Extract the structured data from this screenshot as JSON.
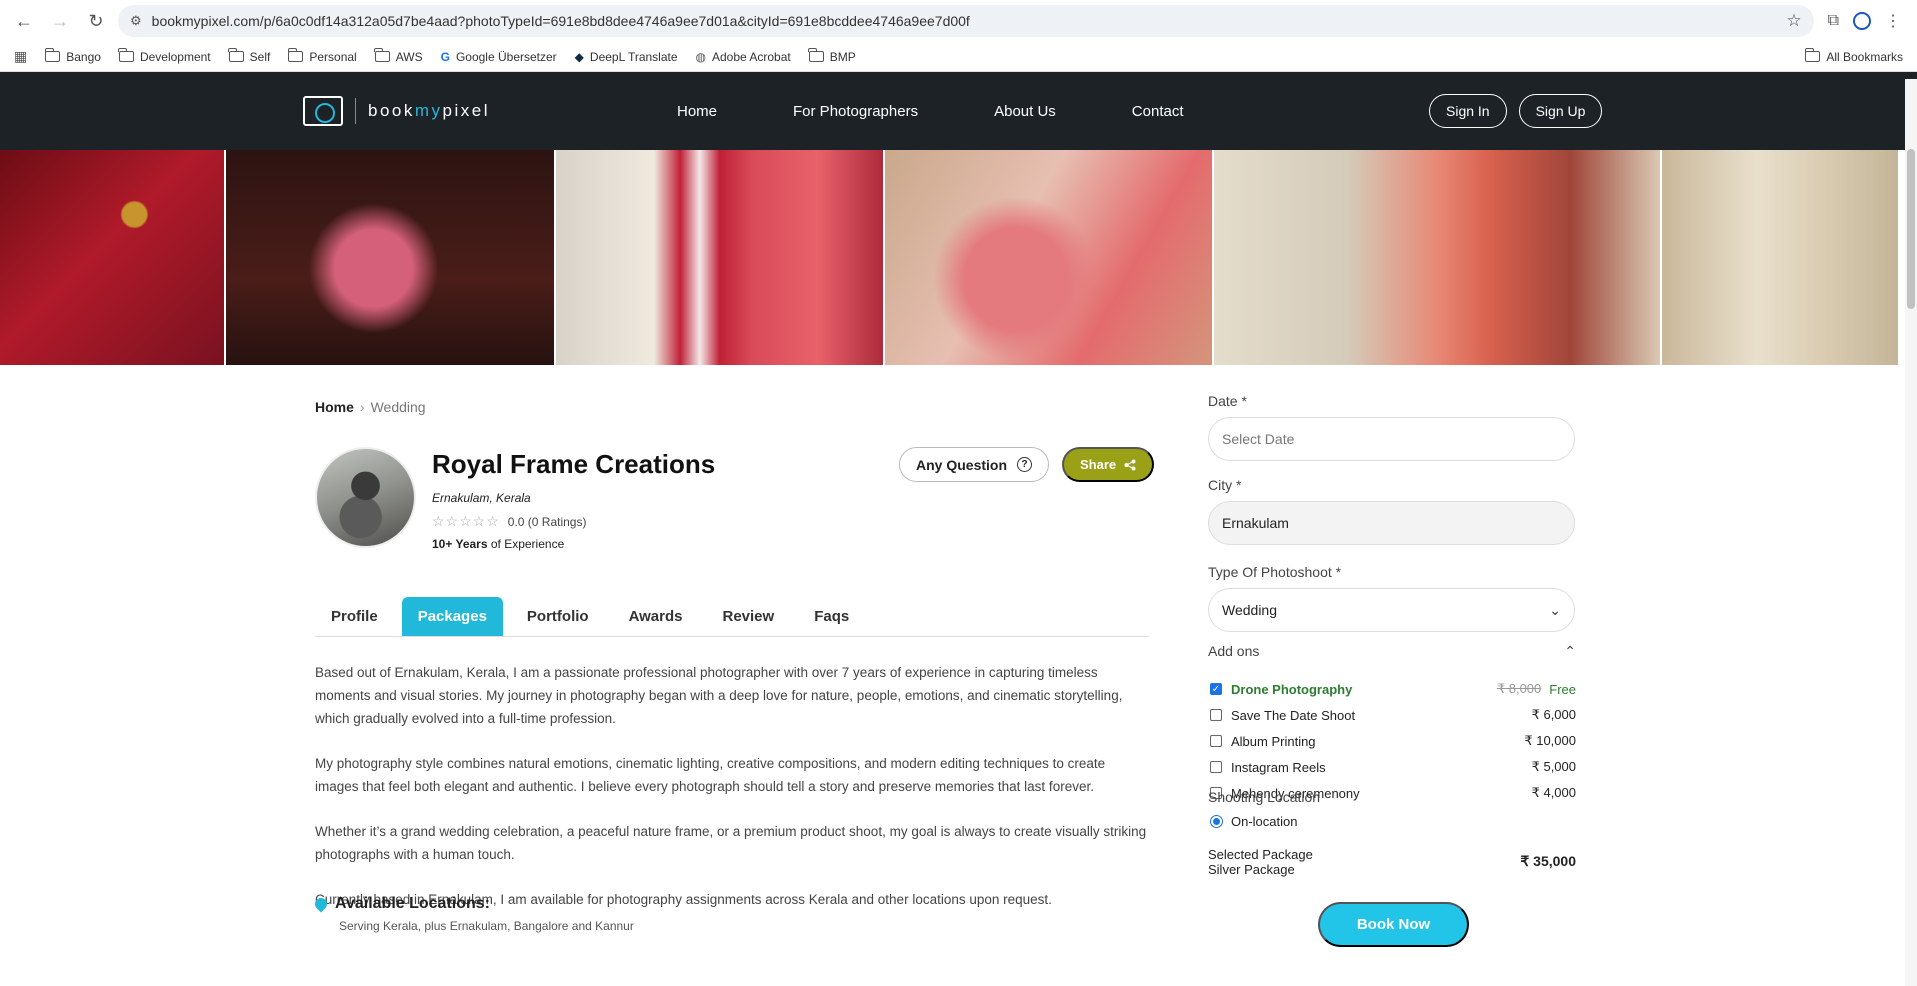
{
  "browser": {
    "url": "bookmypixel.com/p/6a0c0df14a312a05d7be4aad?photoTypeId=691e8bd8dee4746a9ee7d01a&cityId=691e8bcddee4746a9ee7d00f",
    "bookmarks": [
      "Bango",
      "Development",
      "Self",
      "Personal",
      "AWS",
      "Google Übersetzer",
      "DeepL Translate",
      "Adobe Acrobat",
      "BMP"
    ],
    "all_bookmarks": "All Bookmarks"
  },
  "site": {
    "logo_prefix": "book",
    "logo_accent": "my",
    "logo_suffix": "pixel",
    "nav": [
      "Home",
      "For Photographers",
      "About Us",
      "Contact"
    ],
    "sign_in": "Sign In",
    "sign_up": "Sign Up"
  },
  "breadcrumb": {
    "home": "Home",
    "current": "Wedding"
  },
  "profile": {
    "name": "Royal Frame Creations",
    "location": "Ernakulam, Kerala",
    "rating_text": "0.0 (0 Ratings)",
    "experience_bold": "10+ Years",
    "experience_rest": "of Experience",
    "any_question": "Any Question",
    "share": "Share"
  },
  "tabs": [
    "Profile",
    "Packages",
    "Portfolio",
    "Awards",
    "Review",
    "Faqs"
  ],
  "active_tab": "Packages",
  "bio": [
    "Based out of Ernakulam, Kerala, I am a passionate professional photographer with over 7 years of experience in capturing timeless moments and visual stories. My journey in photography began with a deep love for nature, people, emotions, and cinematic storytelling, which gradually evolved into a full-time profession.",
    "My photography style combines natural emotions, cinematic lighting, creative compositions, and modern editing techniques to create images that feel both elegant and authentic. I believe every photograph should tell a story and preserve memories that last forever.",
    "Whether it’s a grand wedding celebration, a peaceful nature frame, or a premium product shoot, my goal is always to create visually striking photographs with a human touch.",
    "Currently based in Ernakulam, I am available for photography assignments across Kerala and other locations upon request."
  ],
  "locations": {
    "title": "Available Locations:",
    "subtitle": "Serving Kerala, plus Ernakulam, Bangalore and Kannur"
  },
  "booking": {
    "date_label": "Date *",
    "date_placeholder": "Select Date",
    "city_label": "City *",
    "city_value": "Ernakulam",
    "type_label": "Type Of Photoshoot *",
    "type_value": "Wedding",
    "addons_label": "Add ons",
    "addons": [
      {
        "name": "Drone Photography",
        "old_price": "₹ 8,000",
        "price": "Free",
        "checked": true
      },
      {
        "name": "Save The Date Shoot",
        "price": "₹ 6,000",
        "checked": false
      },
      {
        "name": "Album Printing",
        "price": "₹ 10,000",
        "checked": false
      },
      {
        "name": "Instagram Reels",
        "price": "₹ 5,000",
        "checked": false
      },
      {
        "name": "Mehendy ceremenony",
        "price": "₹ 4,000",
        "checked": false
      }
    ],
    "shooting_location_label": "Shooting Location",
    "shooting_location_value": "On-location",
    "selected_package_label": "Selected Package",
    "selected_package_name": "Silver Package",
    "selected_package_price": "₹ 35,000",
    "book_now": "Book Now"
  },
  "colors": {
    "accent": "#22b8d9",
    "share": "#9aa117",
    "header": "#1d2226"
  }
}
